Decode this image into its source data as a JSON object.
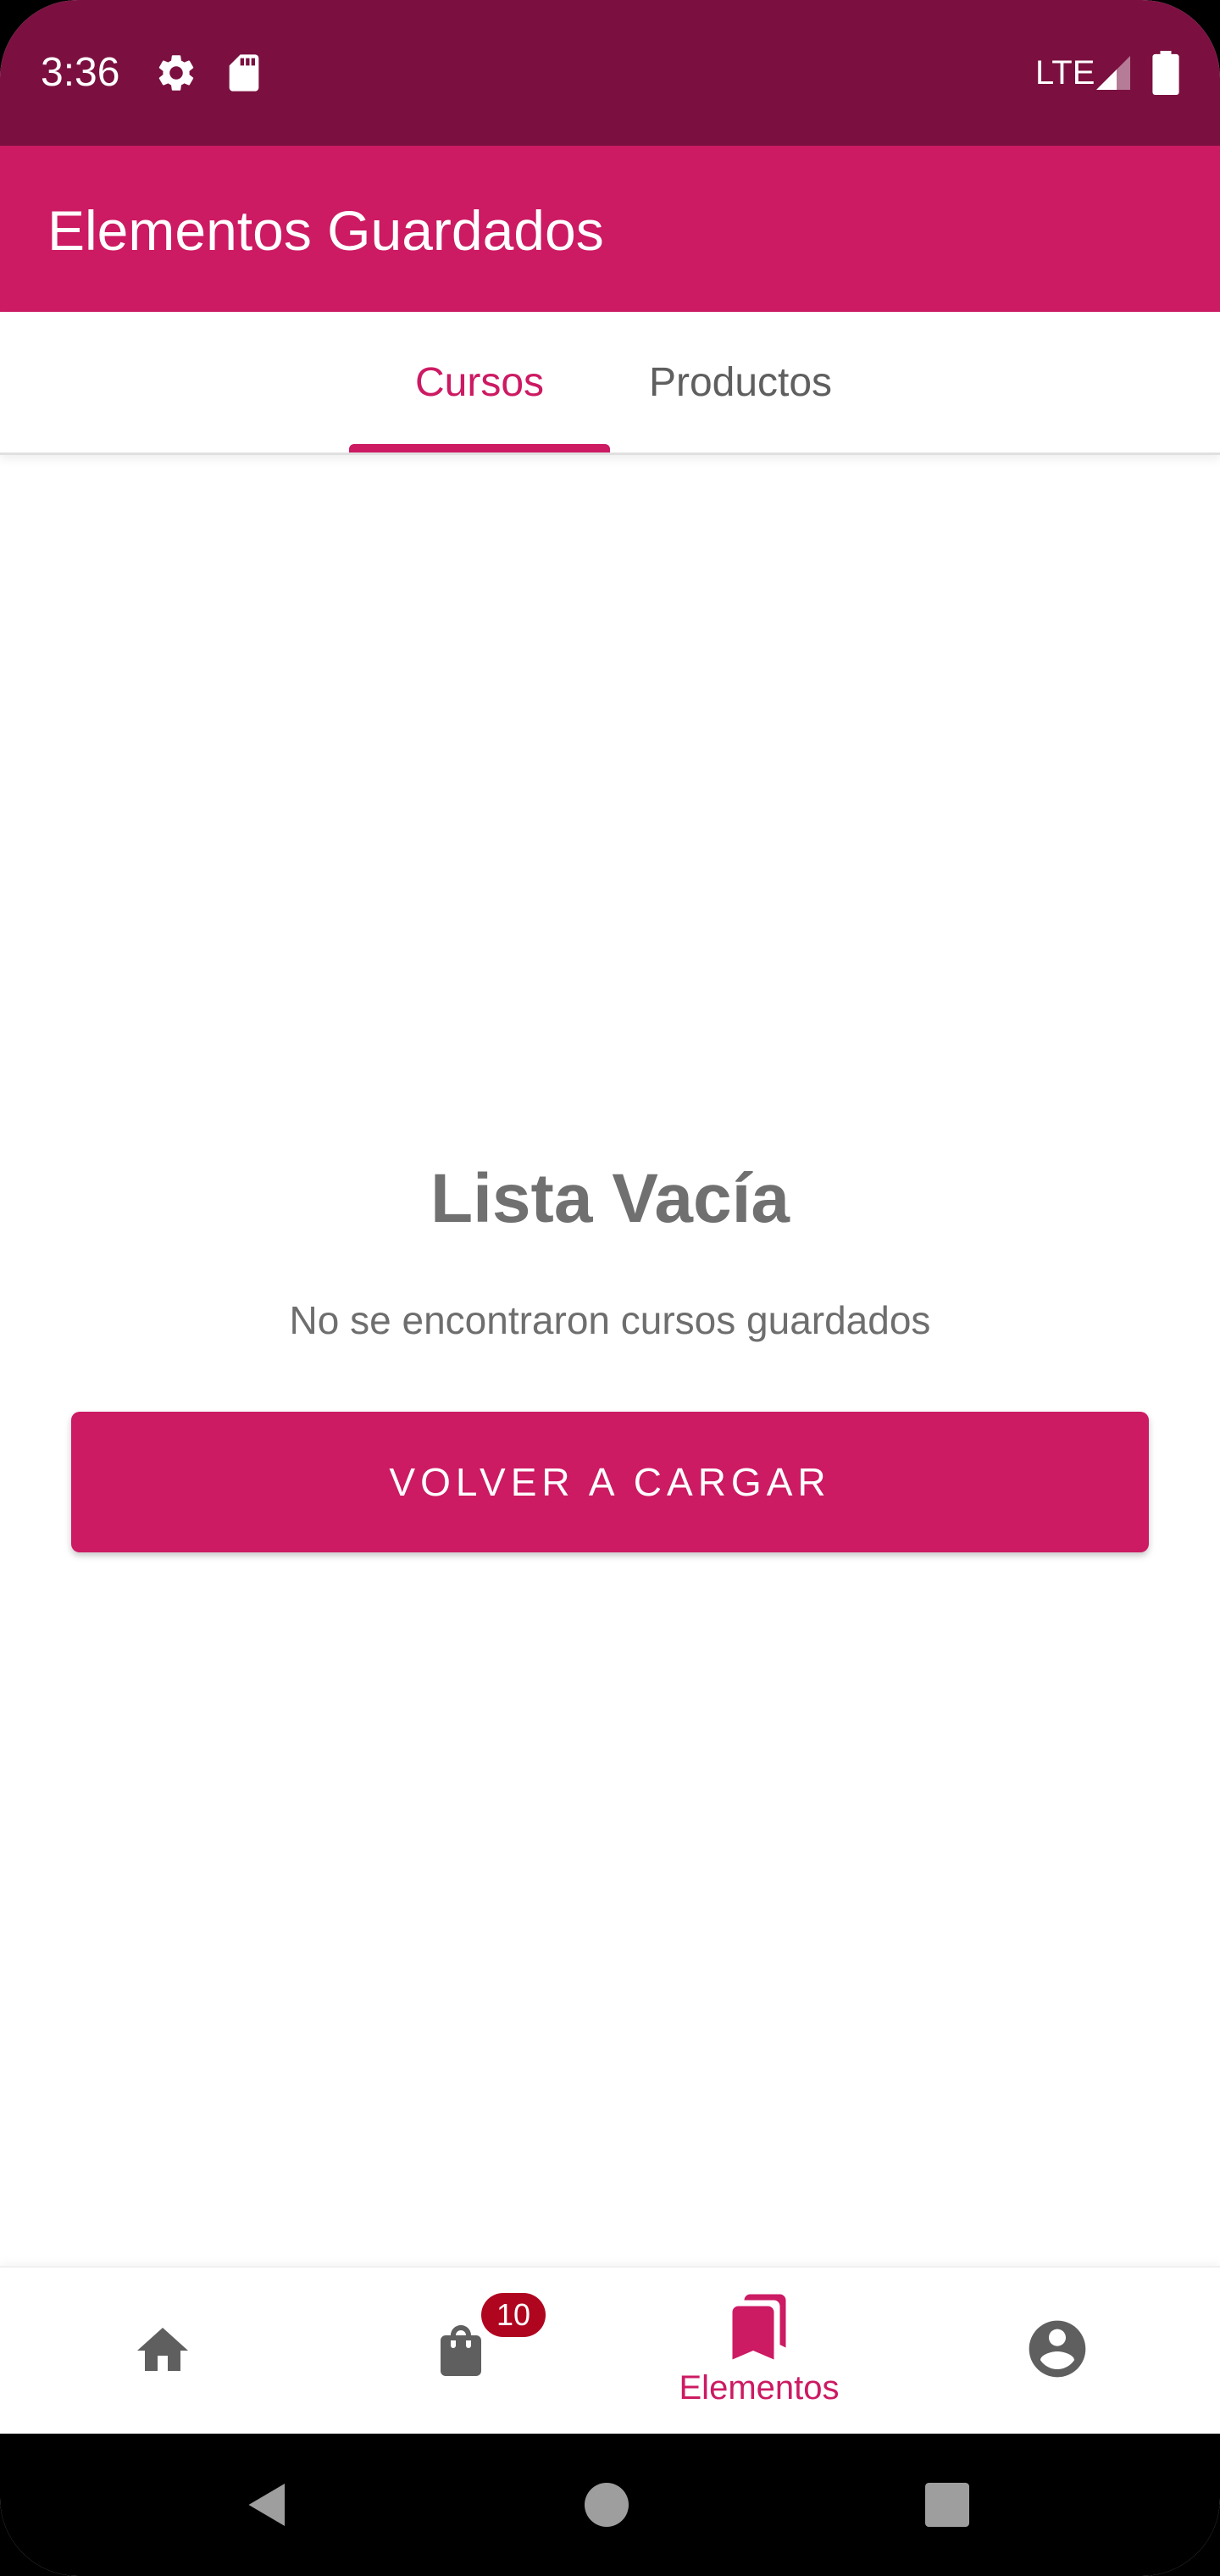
{
  "status_bar": {
    "time": "3:36",
    "network": "LTE",
    "icons": [
      "settings-icon",
      "sd-card-icon",
      "signal-icon",
      "battery-icon"
    ]
  },
  "app_bar": {
    "title": "Elementos Guardados"
  },
  "tabs": [
    {
      "label": "Cursos",
      "selected": true
    },
    {
      "label": "Productos",
      "selected": false
    }
  ],
  "empty_state": {
    "title": "Lista Vacía",
    "message": "No se encontraron cursos guardados",
    "button_label": "VOLVER A CARGAR"
  },
  "bottom_nav": {
    "items": [
      {
        "icon": "home-icon",
        "label": "",
        "selected": false
      },
      {
        "icon": "shopping-bag-icon",
        "label": "",
        "badge": "10",
        "selected": false
      },
      {
        "icon": "bookmarks-icon",
        "label": "Elementos",
        "selected": true
      },
      {
        "icon": "account-circle-icon",
        "label": "",
        "selected": false
      }
    ]
  },
  "system_nav": {
    "icons": [
      "back-icon",
      "home-circle-icon",
      "recents-icon"
    ]
  },
  "colors": {
    "status_bar": "#7b1040",
    "primary": "#cc1a63",
    "badge": "#b0051f",
    "text_gray": "#707070",
    "icon_gray": "#5f5f5f"
  }
}
